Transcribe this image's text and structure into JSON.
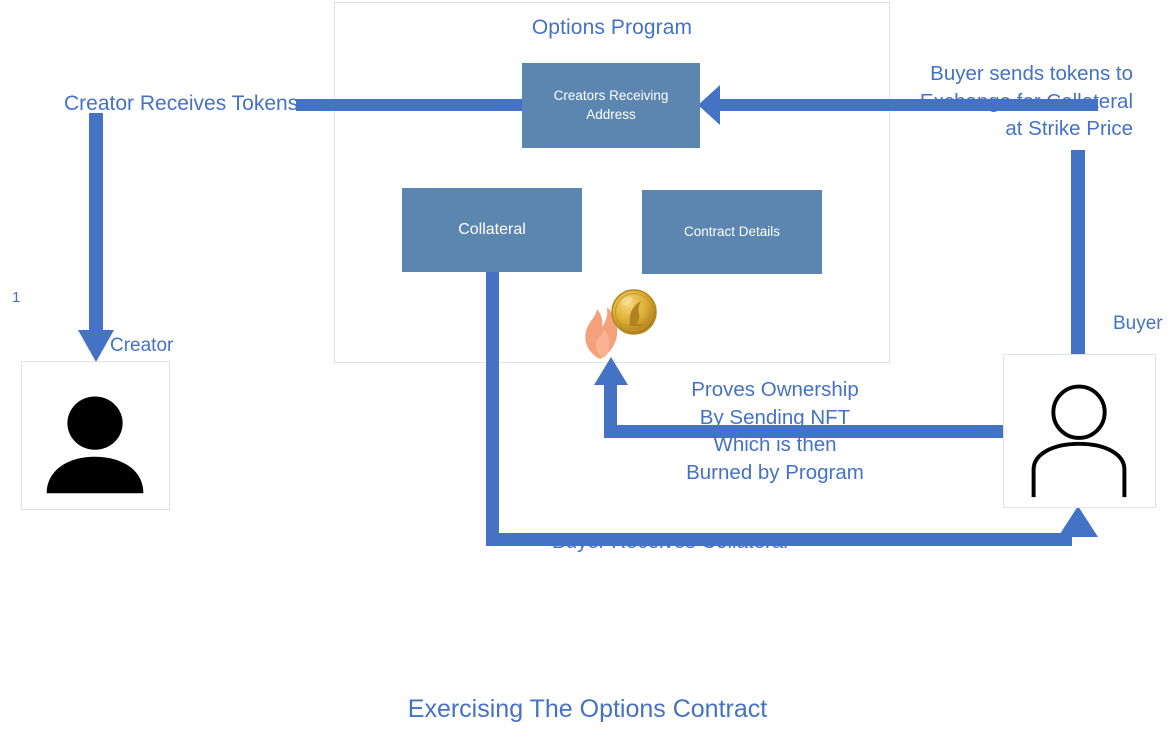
{
  "diagram": {
    "title": "Exercising The Options Contract",
    "step_number": "1"
  },
  "program": {
    "title": "Options Program",
    "boxes": [
      {
        "id": "creators-receiving-address",
        "label": "Creators Receiving Address"
      },
      {
        "id": "collateral",
        "label": "Collateral"
      },
      {
        "id": "contract-details",
        "label": "Contract Details"
      }
    ]
  },
  "actors": [
    {
      "id": "creator",
      "label": "Creator",
      "icon": "person-filled-icon"
    },
    {
      "id": "buyer",
      "label": "Buyer",
      "icon": "person-outline-icon"
    }
  ],
  "flows": {
    "creator_receives_tokens": "Creator Receives Tokens",
    "buyer_sends_tokens": "Buyer sends tokens to\nExchange for Collateral\nat Strike Price",
    "proves_ownership": "Proves Ownership\nBy Sending NFT\nWhich is then\nBurned by Program",
    "buyer_receives_collateral": "Buyer Receives Collateral"
  },
  "icons": {
    "burn": "fire-icon",
    "token": "gold-coin-icon"
  },
  "colors": {
    "accent_blue": "#4472c4",
    "box_fill": "#5b86b0",
    "box_border": "#e2e2e2",
    "flame": "#f4a07a",
    "coin": "#d8a41e",
    "text_blue": "#4472c4"
  }
}
